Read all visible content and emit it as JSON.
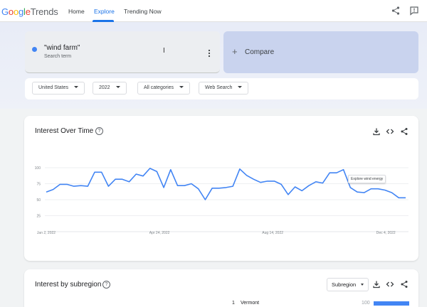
{
  "app": {
    "logo_google": "Google",
    "logo_trends": "Trends",
    "nav": [
      {
        "label": "Home"
      },
      {
        "label": "Explore"
      },
      {
        "label": "Trending Now"
      }
    ],
    "active_nav": "Explore"
  },
  "search": {
    "term": "\"wind farm\"",
    "term_type": "Search term",
    "term_color": "#4285f4",
    "compare_label": "Compare"
  },
  "filters": {
    "region": "United States",
    "year": "2022",
    "category": "All categories",
    "search_type": "Web Search"
  },
  "interest_over_time": {
    "title": "Interest Over Time",
    "tooltip": "Explore wind energy",
    "chart_data": {
      "type": "line",
      "x_tick_labels": [
        "Jan 2, 2022",
        "Apr 24, 2022",
        "Aug 14, 2022",
        "Dec 4, 2022"
      ],
      "y_tick_labels": [
        "100",
        "75",
        "50",
        "25"
      ],
      "ylim": [
        0,
        100
      ],
      "grid": true,
      "series": [
        {
          "color": "#4285f4",
          "values": [
            62,
            66,
            74,
            74,
            71,
            72,
            71,
            93,
            93,
            71,
            82,
            82,
            78,
            90,
            87,
            99,
            94,
            69,
            97,
            72,
            72,
            75,
            67,
            50,
            68,
            68,
            69,
            71,
            98,
            88,
            82,
            77,
            79,
            79,
            74,
            58,
            70,
            64,
            72,
            78,
            76,
            92,
            92,
            97,
            69,
            62,
            61,
            67,
            67,
            65,
            61,
            53,
            53
          ]
        }
      ]
    }
  },
  "interest_by_subregion": {
    "title": "Interest by subregion",
    "selector": "Subregion",
    "rows": [
      {
        "rank": "1",
        "name": "Vermont",
        "value": "100",
        "level": 100
      }
    ]
  }
}
